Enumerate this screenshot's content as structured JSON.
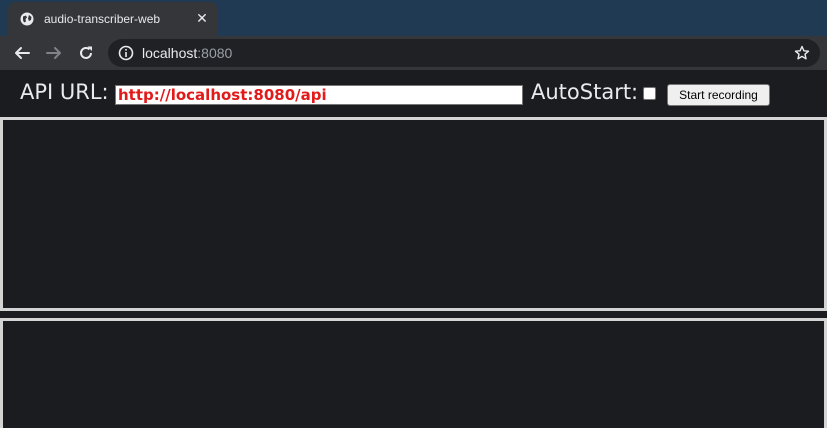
{
  "browser": {
    "tab_title": "audio-transcriber-web",
    "url_host": "localhost",
    "url_port": ":8080",
    "icons": {
      "tab": "globe-icon",
      "close": "close-icon",
      "back": "back-arrow-icon",
      "forward": "forward-arrow-icon",
      "reload": "reload-icon",
      "site_info": "info-icon",
      "bookmark": "star-icon"
    }
  },
  "controls": {
    "api_label": "API URL:",
    "api_value": "http://localhost:8080/api",
    "autostart_label": "AutoStart:",
    "autostart_checked": false,
    "start_button": "Start recording"
  },
  "colors": {
    "api_value_text": "#e11a1a",
    "page_background": "#1b1c1f",
    "panel_border": "#d4d4d4"
  }
}
